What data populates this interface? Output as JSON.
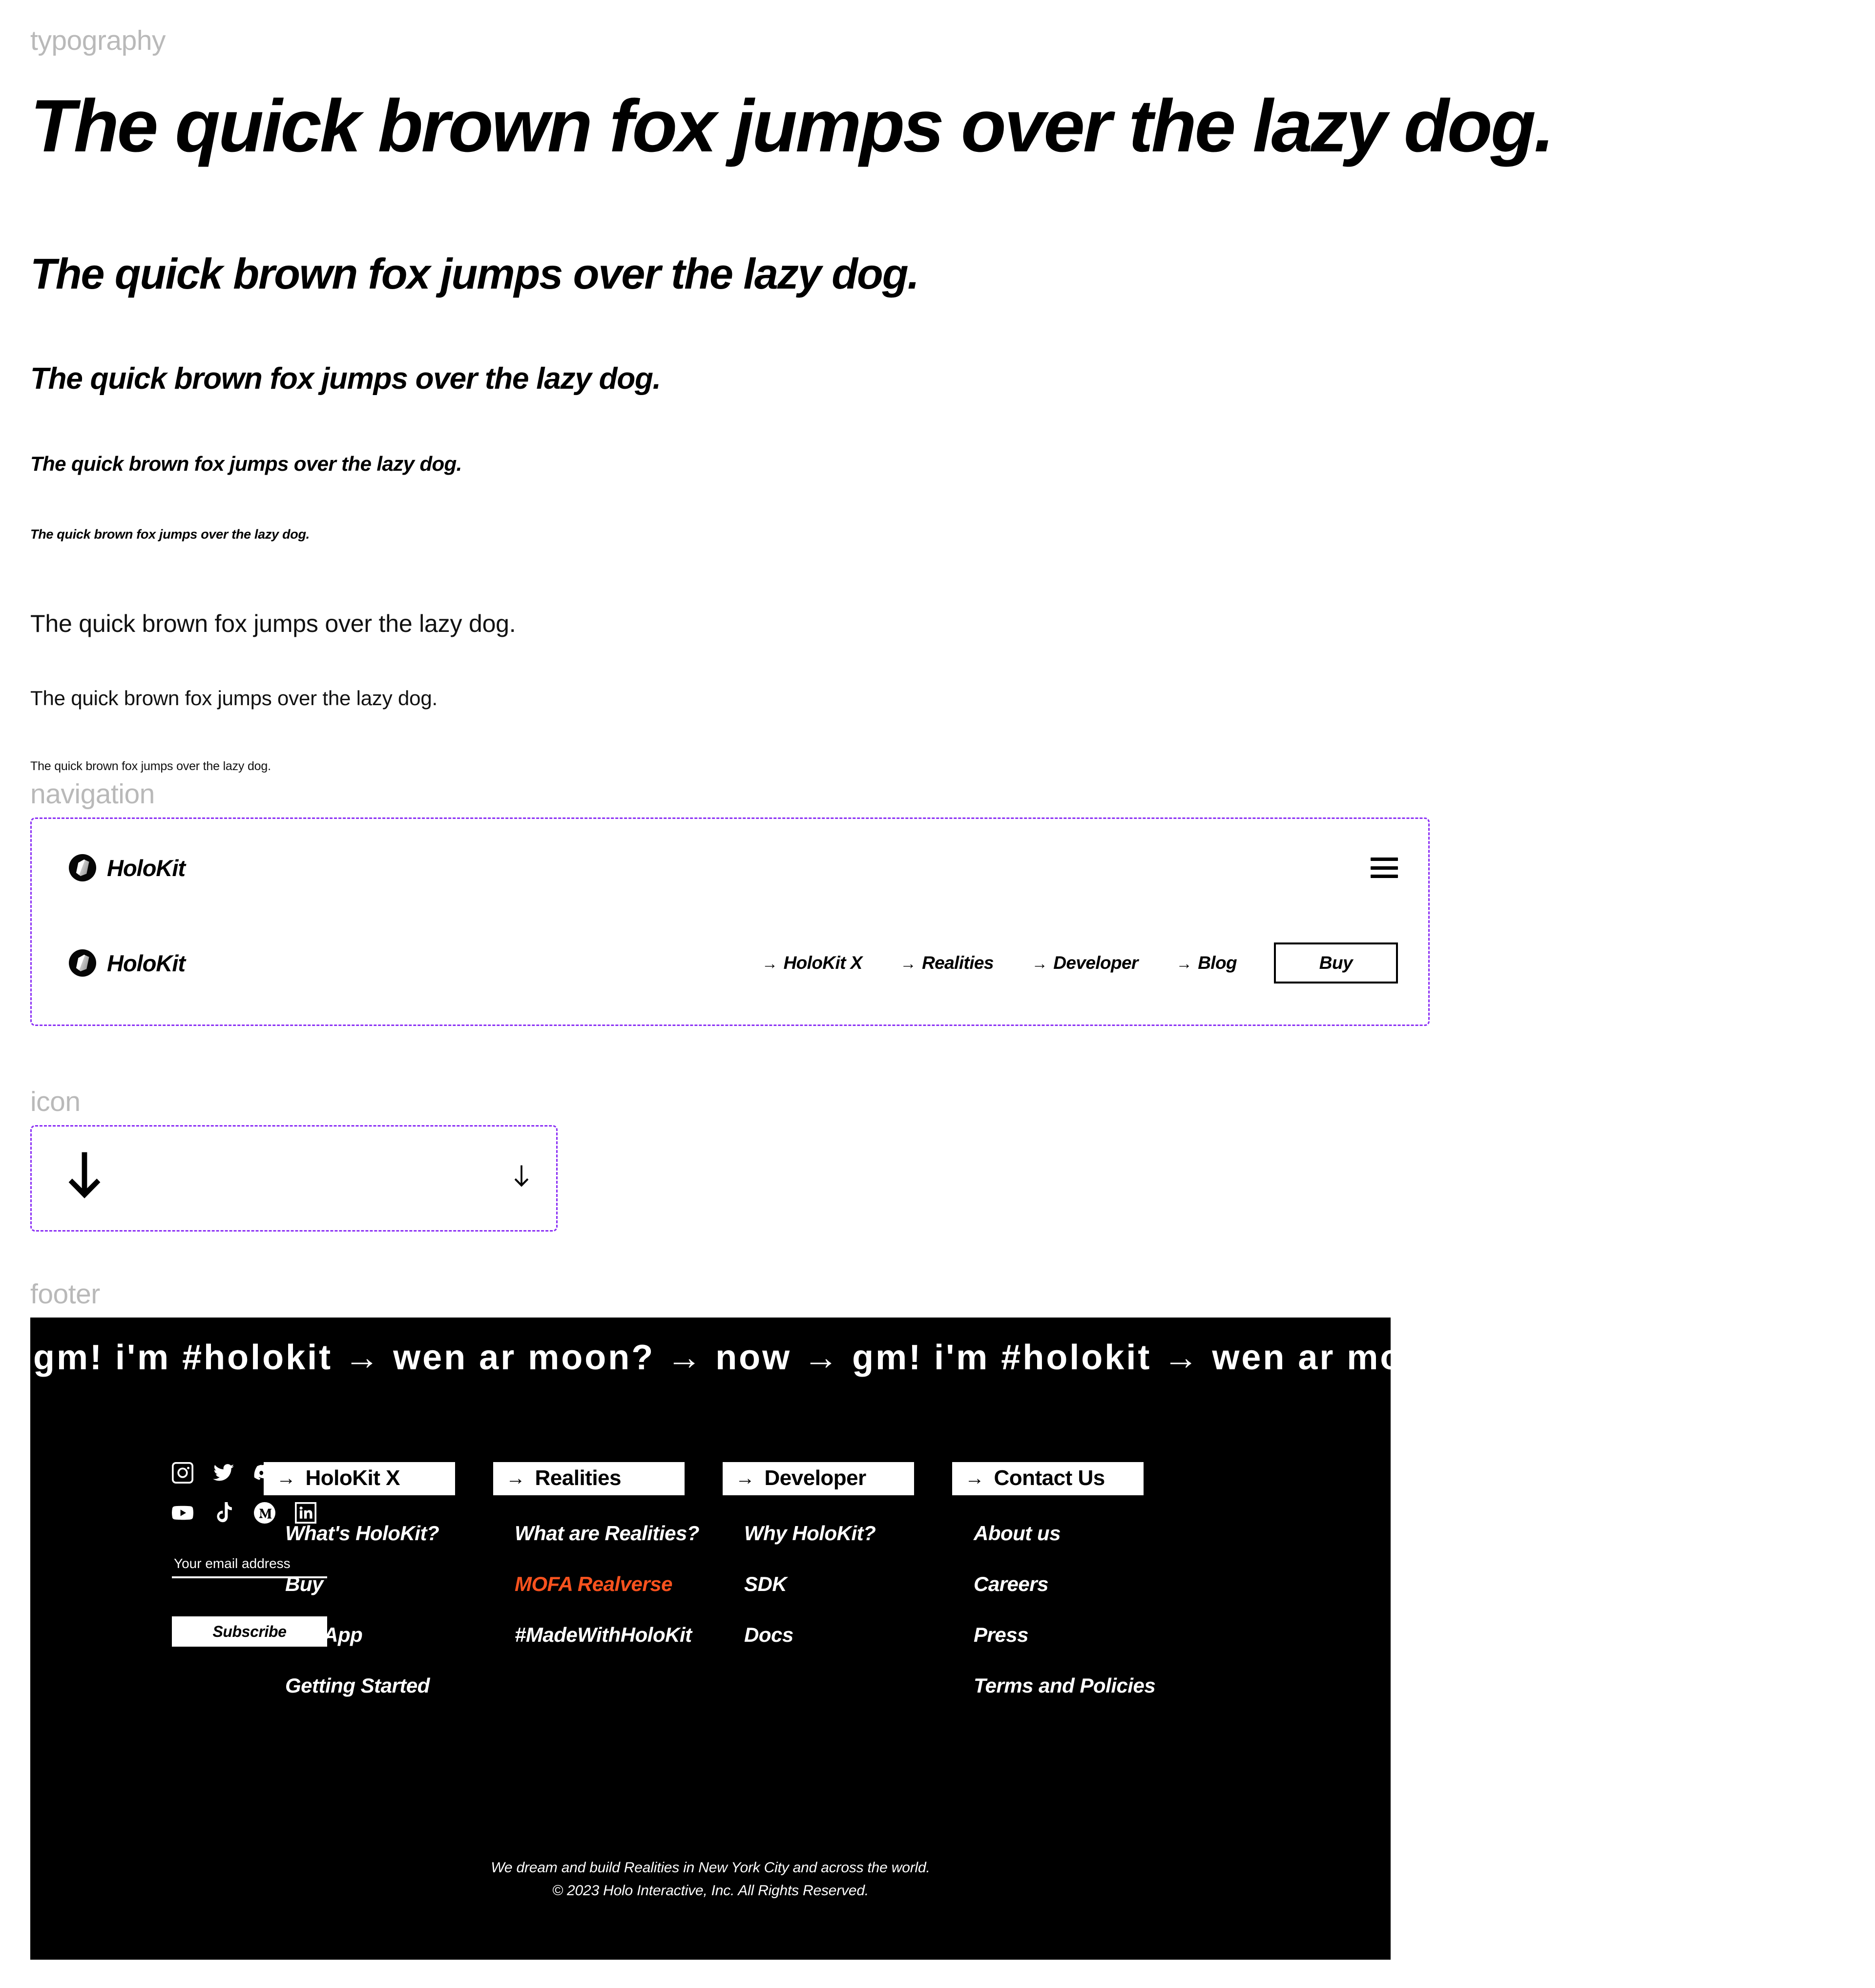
{
  "sections": {
    "typography_label": "typography",
    "navigation_label": "navigation",
    "icon_label": "icon",
    "footer_label": "footer"
  },
  "typography": {
    "samples": [
      {
        "text": "The quick brown fox jumps over the lazy dog.",
        "style": "display-1"
      },
      {
        "text": "The quick brown fox jumps over the lazy dog.",
        "style": "display-2"
      },
      {
        "text": "The quick brown fox jumps over the lazy dog.",
        "style": "display-3"
      },
      {
        "text": "The quick brown fox jumps over the lazy dog.",
        "style": "display-4"
      },
      {
        "text": "The quick brown fox jumps over the lazy dog.",
        "style": "display-5"
      },
      {
        "text": "The quick brown fox jumps over the lazy dog.",
        "style": "body-1"
      },
      {
        "text": "The quick brown fox jumps over the lazy dog.",
        "style": "body-2"
      },
      {
        "text": "The quick brown fox jumps over the lazy dog.",
        "style": "body-3"
      }
    ]
  },
  "navigation": {
    "brand": "HoloKit",
    "menu_icon": "hamburger-icon",
    "arrow_glyph": "→",
    "links": [
      {
        "label": "HoloKit X"
      },
      {
        "label": "Realities"
      },
      {
        "label": "Developer"
      },
      {
        "label": "Blog"
      }
    ],
    "buy_label": "Buy"
  },
  "icons": {
    "items": [
      {
        "name": "arrow-down-large",
        "glyph": "arrow-down"
      },
      {
        "name": "arrow-down-small",
        "glyph": "arrow-down"
      }
    ]
  },
  "footer": {
    "marquee": "gm! i'm #holokit → wen ar moon? → now → gm! i'm #holokit → wen ar moon?",
    "social": [
      {
        "name": "instagram-icon"
      },
      {
        "name": "twitter-icon"
      },
      {
        "name": "discord-icon"
      },
      {
        "name": "email-icon"
      },
      {
        "name": "youtube-icon"
      },
      {
        "name": "tiktok-icon"
      },
      {
        "name": "medium-icon"
      },
      {
        "name": "linkedin-icon"
      }
    ],
    "email_placeholder": "Your email address",
    "email_value": "",
    "subscribe_label": "Subscribe",
    "arrow_glyph": "→",
    "columns": [
      {
        "title": "HoloKit X",
        "links": [
          {
            "label": "What's HoloKit?",
            "accent": false
          },
          {
            "label": "Buy",
            "accent": false
          },
          {
            "label": "Get App",
            "accent": false
          },
          {
            "label": "Getting Started",
            "accent": false
          }
        ]
      },
      {
        "title": "Realities",
        "links": [
          {
            "label": "What are Realities?",
            "accent": false
          },
          {
            "label": "MOFA Realverse",
            "accent": true
          },
          {
            "label": "#MadeWithHoloKit",
            "accent": false
          }
        ]
      },
      {
        "title": "Developer",
        "links": [
          {
            "label": "Why HoloKit?",
            "accent": false
          },
          {
            "label": "SDK",
            "accent": false
          },
          {
            "label": "Docs",
            "accent": false
          }
        ]
      },
      {
        "title": "Contact Us",
        "links": [
          {
            "label": "About us",
            "accent": false
          },
          {
            "label": "Careers",
            "accent": false
          },
          {
            "label": "Press",
            "accent": false
          },
          {
            "label": "Terms and Policies",
            "accent": false
          }
        ]
      }
    ],
    "tagline": "We dream and build Realities in New York City and across the world.",
    "copyright": "© 2023 Holo Interactive, Inc. All Rights Reserved."
  },
  "colors": {
    "accent": "#f8521e",
    "label_gray": "#b9b9b9",
    "dashed_purple": "#8b2ff5",
    "black": "#000000",
    "white": "#ffffff"
  }
}
